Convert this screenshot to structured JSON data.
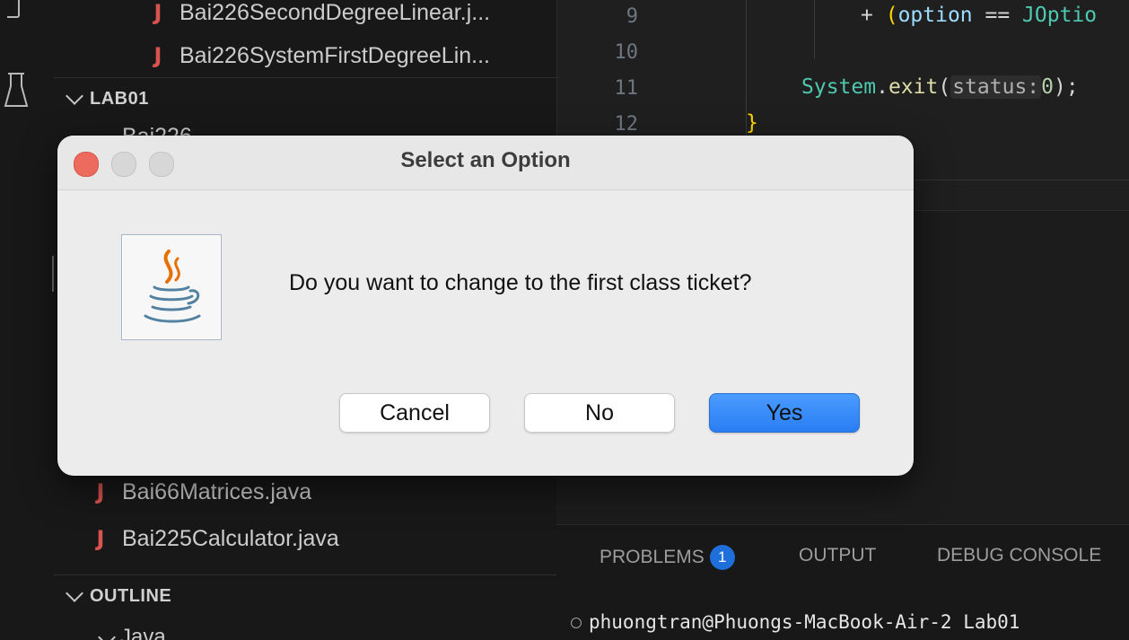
{
  "sidebar": {
    "top_files": [
      {
        "name": "Bai226SecondDegreeLinear.j..."
      },
      {
        "name": "Bai226SystemFirstDegreeLin..."
      }
    ],
    "lab_section": {
      "label": "LAB01"
    },
    "partial_item": "Bai226",
    "lower_files": [
      {
        "name": "Bai66Matrices.java"
      },
      {
        "name": "Bai225Calculator.java"
      }
    ],
    "outline_section": {
      "label": "OUTLINE"
    },
    "outline_partial": "Java"
  },
  "editor": {
    "line_numbers": [
      "9",
      "10",
      "11",
      "12"
    ],
    "line9": {
      "plus": "+ ",
      "paren": "(",
      "var": "option",
      "op": " == ",
      "cls": "JOptio"
    },
    "line11": {
      "cls": "System",
      "dot": ".",
      "method": "exit",
      "open": "(",
      "hint": "status:",
      "num": "0",
      "close": ");"
    },
    "line12": {
      "brace": "}"
    }
  },
  "panel": {
    "tabs": {
      "problems": "PROBLEMS",
      "problems_count": "1",
      "output": "OUTPUT",
      "debug": "DEBUG CONSOLE"
    },
    "terminal": {
      "prompt": "phuongtran@Phuongs-MacBook-Air-2 Lab01"
    }
  },
  "dialog": {
    "title": "Select an Option",
    "message": "Do you want to change to the first class ticket?",
    "buttons": {
      "cancel": "Cancel",
      "no": "No",
      "yes": "Yes"
    },
    "icon": "java-coffee-cup-icon"
  },
  "colors": {
    "accent": "#2a7ef2",
    "close_button": "#ed6a5e",
    "java_file_icon": "#d9534f",
    "badge": "#1e6fd9"
  }
}
